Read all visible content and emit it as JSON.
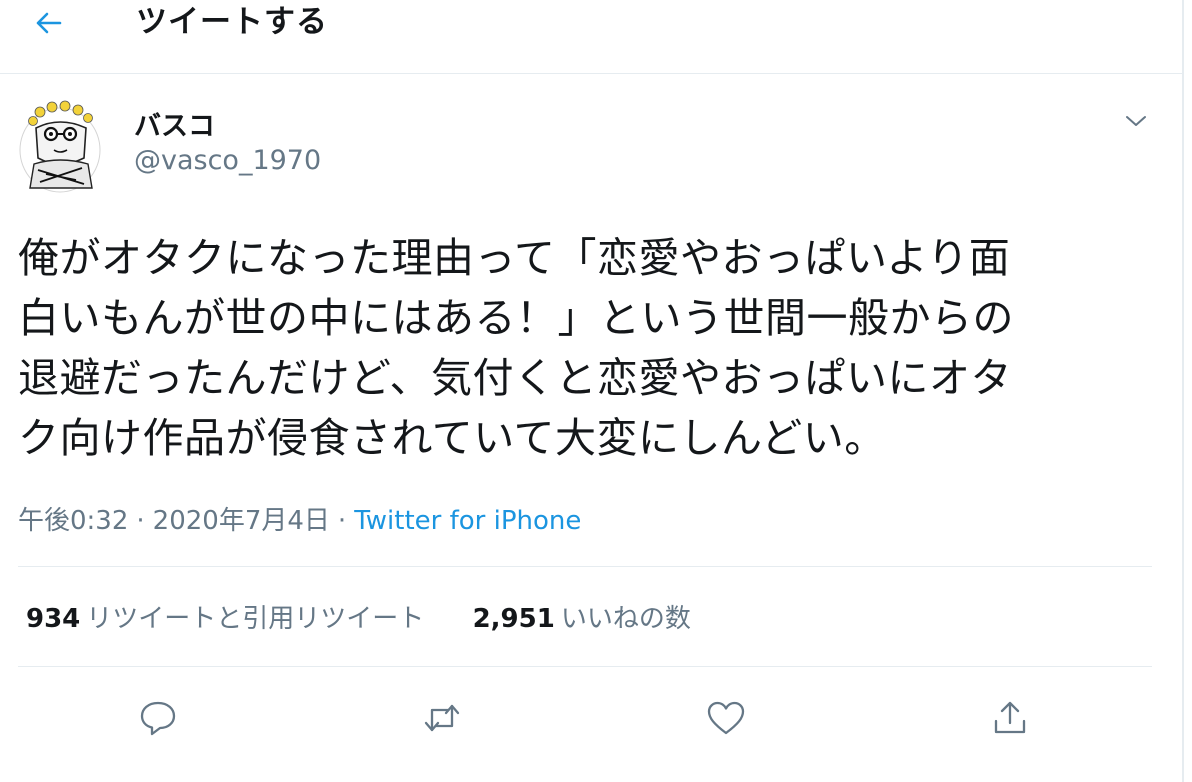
{
  "header": {
    "title": "ツイートする",
    "back_icon": "arrow-left-icon"
  },
  "colors": {
    "accent": "#1b95e0",
    "text": "#14171a",
    "muted": "#657786",
    "divider": "#e6ecf0"
  },
  "tweet": {
    "author_name": "バスコ",
    "author_handle": "@vasco_1970",
    "text_lines": [
      "俺がオタクになった理由って「恋愛やおっぱいより面",
      "白いもんが世の中にはある！」という世間一般からの",
      "退避だったんだけど、気付くと恋愛やおっぱいにオタ",
      "ク向け作品が侵食されていて大変にしんどい。"
    ],
    "time": "午後0:32",
    "separator": "·",
    "date": "2020年7月4日",
    "source": "Twitter for iPhone"
  },
  "stats": {
    "retweets": {
      "count": "934",
      "label": "リツイートと引用リツイート"
    },
    "likes": {
      "count": "2,951",
      "label": "いいねの数"
    }
  },
  "actions": [
    "reply-icon",
    "retweet-icon",
    "like-icon",
    "share-icon"
  ]
}
